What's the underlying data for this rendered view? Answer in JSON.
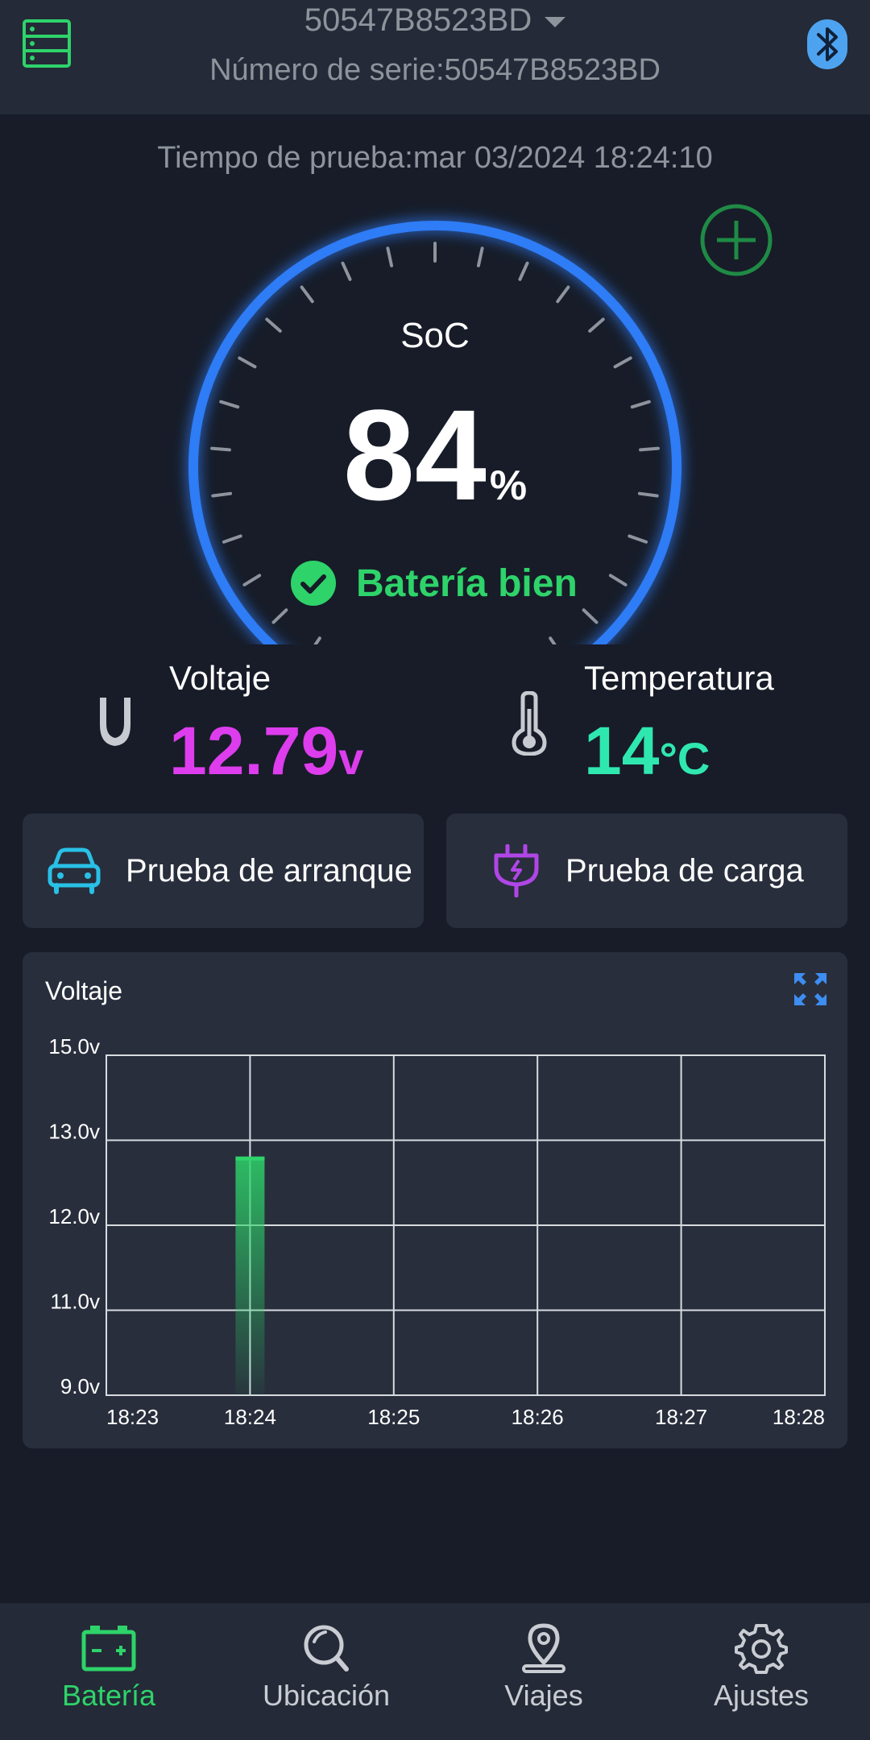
{
  "header": {
    "device_name": "50547B8523BD",
    "serial_line": "Número de serie:50547B8523BD"
  },
  "test_time": "Tiempo de prueba:mar 03/2024 18:24:10",
  "gauge": {
    "label": "SoC",
    "value": "84",
    "unit": "%",
    "fill_fraction": 1.0,
    "status_text": "Batería bien"
  },
  "metrics": {
    "voltage": {
      "label": "Voltaje",
      "value": "12.79",
      "unit": "v"
    },
    "temperature": {
      "label": "Temperatura",
      "value": "14",
      "unit": "°C"
    }
  },
  "actions": {
    "crank_test": "Prueba de arranque",
    "charge_test": "Prueba de carga"
  },
  "chart_data": {
    "type": "bar",
    "title": "Voltaje",
    "x_ticks": [
      "18:23",
      "18:24",
      "18:25",
      "18:26",
      "18:27",
      "18:28"
    ],
    "y_ticks": [
      "15.0v",
      "13.0v",
      "12.0v",
      "11.0v",
      "9.0v"
    ],
    "y_tick_values": [
      15.0,
      13.0,
      12.0,
      11.0,
      9.0
    ],
    "x": [
      "18:24"
    ],
    "values": [
      12.79
    ],
    "ylim": [
      9.0,
      15.0
    ],
    "grid": true,
    "bar_color": "#2ed36a"
  },
  "nav": {
    "items": [
      {
        "label": "Batería",
        "icon": "battery-icon",
        "active": true
      },
      {
        "label": "Ubicación",
        "icon": "search-icon",
        "active": false
      },
      {
        "label": "Viajes",
        "icon": "location-pin-icon",
        "active": false
      },
      {
        "label": "Ajustes",
        "icon": "gear-icon",
        "active": false
      }
    ]
  },
  "colors": {
    "background": "#171c28",
    "card": "#282e3c",
    "accent_green": "#2ed36a",
    "gauge_blue": "#2f7cf6",
    "voltage": "#dd3ded",
    "temperature": "#2fe8b0"
  }
}
